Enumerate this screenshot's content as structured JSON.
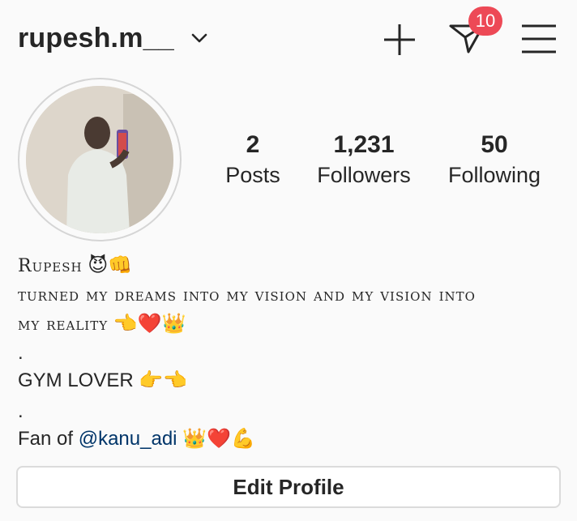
{
  "header": {
    "username": "rupesh.m__",
    "notification_count": "10",
    "icons": [
      "chevron-down-icon",
      "plus-icon",
      "send-icon",
      "menu-icon"
    ]
  },
  "stats": [
    {
      "num": "2",
      "label": "Posts"
    },
    {
      "num": "1,231",
      "label": "Followers"
    },
    {
      "num": "50",
      "label": "Following"
    }
  ],
  "bio": {
    "name": "Rupesh",
    "name_emoji": "😈👊",
    "line1": "turned my dreams into my vision and my vision into",
    "line2": "my reality",
    "line2_emoji": "👈❤️👑",
    "dot1": ".",
    "gym": "GYM LOVER",
    "gym_emoji": "👉👈",
    "dot2": ".",
    "fan_prefix": "Fan of ",
    "fan_mention": "@kanu_adi",
    "fan_emoji": "👑❤️💪"
  },
  "buttons": {
    "edit_profile": "Edit Profile"
  },
  "colors": {
    "badge": "#ed4956",
    "mention": "#003569",
    "text": "#262626"
  }
}
